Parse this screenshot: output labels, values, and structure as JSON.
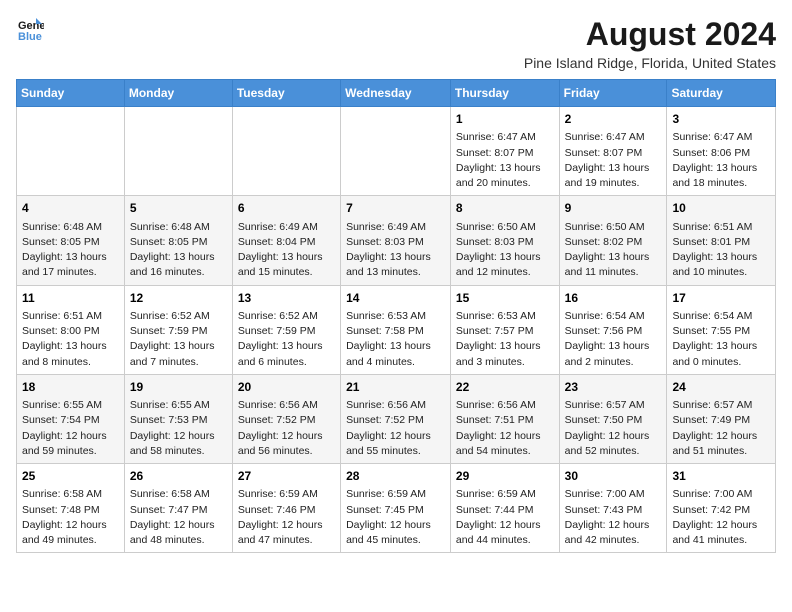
{
  "logo": {
    "line1": "General",
    "line2": "Blue"
  },
  "title": "August 2024",
  "location": "Pine Island Ridge, Florida, United States",
  "weekdays": [
    "Sunday",
    "Monday",
    "Tuesday",
    "Wednesday",
    "Thursday",
    "Friday",
    "Saturday"
  ],
  "weeks": [
    [
      {
        "day": "",
        "info": ""
      },
      {
        "day": "",
        "info": ""
      },
      {
        "day": "",
        "info": ""
      },
      {
        "day": "",
        "info": ""
      },
      {
        "day": "1",
        "info": "Sunrise: 6:47 AM\nSunset: 8:07 PM\nDaylight: 13 hours\nand 20 minutes."
      },
      {
        "day": "2",
        "info": "Sunrise: 6:47 AM\nSunset: 8:07 PM\nDaylight: 13 hours\nand 19 minutes."
      },
      {
        "day": "3",
        "info": "Sunrise: 6:47 AM\nSunset: 8:06 PM\nDaylight: 13 hours\nand 18 minutes."
      }
    ],
    [
      {
        "day": "4",
        "info": "Sunrise: 6:48 AM\nSunset: 8:05 PM\nDaylight: 13 hours\nand 17 minutes."
      },
      {
        "day": "5",
        "info": "Sunrise: 6:48 AM\nSunset: 8:05 PM\nDaylight: 13 hours\nand 16 minutes."
      },
      {
        "day": "6",
        "info": "Sunrise: 6:49 AM\nSunset: 8:04 PM\nDaylight: 13 hours\nand 15 minutes."
      },
      {
        "day": "7",
        "info": "Sunrise: 6:49 AM\nSunset: 8:03 PM\nDaylight: 13 hours\nand 13 minutes."
      },
      {
        "day": "8",
        "info": "Sunrise: 6:50 AM\nSunset: 8:03 PM\nDaylight: 13 hours\nand 12 minutes."
      },
      {
        "day": "9",
        "info": "Sunrise: 6:50 AM\nSunset: 8:02 PM\nDaylight: 13 hours\nand 11 minutes."
      },
      {
        "day": "10",
        "info": "Sunrise: 6:51 AM\nSunset: 8:01 PM\nDaylight: 13 hours\nand 10 minutes."
      }
    ],
    [
      {
        "day": "11",
        "info": "Sunrise: 6:51 AM\nSunset: 8:00 PM\nDaylight: 13 hours\nand 8 minutes."
      },
      {
        "day": "12",
        "info": "Sunrise: 6:52 AM\nSunset: 7:59 PM\nDaylight: 13 hours\nand 7 minutes."
      },
      {
        "day": "13",
        "info": "Sunrise: 6:52 AM\nSunset: 7:59 PM\nDaylight: 13 hours\nand 6 minutes."
      },
      {
        "day": "14",
        "info": "Sunrise: 6:53 AM\nSunset: 7:58 PM\nDaylight: 13 hours\nand 4 minutes."
      },
      {
        "day": "15",
        "info": "Sunrise: 6:53 AM\nSunset: 7:57 PM\nDaylight: 13 hours\nand 3 minutes."
      },
      {
        "day": "16",
        "info": "Sunrise: 6:54 AM\nSunset: 7:56 PM\nDaylight: 13 hours\nand 2 minutes."
      },
      {
        "day": "17",
        "info": "Sunrise: 6:54 AM\nSunset: 7:55 PM\nDaylight: 13 hours\nand 0 minutes."
      }
    ],
    [
      {
        "day": "18",
        "info": "Sunrise: 6:55 AM\nSunset: 7:54 PM\nDaylight: 12 hours\nand 59 minutes."
      },
      {
        "day": "19",
        "info": "Sunrise: 6:55 AM\nSunset: 7:53 PM\nDaylight: 12 hours\nand 58 minutes."
      },
      {
        "day": "20",
        "info": "Sunrise: 6:56 AM\nSunset: 7:52 PM\nDaylight: 12 hours\nand 56 minutes."
      },
      {
        "day": "21",
        "info": "Sunrise: 6:56 AM\nSunset: 7:52 PM\nDaylight: 12 hours\nand 55 minutes."
      },
      {
        "day": "22",
        "info": "Sunrise: 6:56 AM\nSunset: 7:51 PM\nDaylight: 12 hours\nand 54 minutes."
      },
      {
        "day": "23",
        "info": "Sunrise: 6:57 AM\nSunset: 7:50 PM\nDaylight: 12 hours\nand 52 minutes."
      },
      {
        "day": "24",
        "info": "Sunrise: 6:57 AM\nSunset: 7:49 PM\nDaylight: 12 hours\nand 51 minutes."
      }
    ],
    [
      {
        "day": "25",
        "info": "Sunrise: 6:58 AM\nSunset: 7:48 PM\nDaylight: 12 hours\nand 49 minutes."
      },
      {
        "day": "26",
        "info": "Sunrise: 6:58 AM\nSunset: 7:47 PM\nDaylight: 12 hours\nand 48 minutes."
      },
      {
        "day": "27",
        "info": "Sunrise: 6:59 AM\nSunset: 7:46 PM\nDaylight: 12 hours\nand 47 minutes."
      },
      {
        "day": "28",
        "info": "Sunrise: 6:59 AM\nSunset: 7:45 PM\nDaylight: 12 hours\nand 45 minutes."
      },
      {
        "day": "29",
        "info": "Sunrise: 6:59 AM\nSunset: 7:44 PM\nDaylight: 12 hours\nand 44 minutes."
      },
      {
        "day": "30",
        "info": "Sunrise: 7:00 AM\nSunset: 7:43 PM\nDaylight: 12 hours\nand 42 minutes."
      },
      {
        "day": "31",
        "info": "Sunrise: 7:00 AM\nSunset: 7:42 PM\nDaylight: 12 hours\nand 41 minutes."
      }
    ]
  ]
}
